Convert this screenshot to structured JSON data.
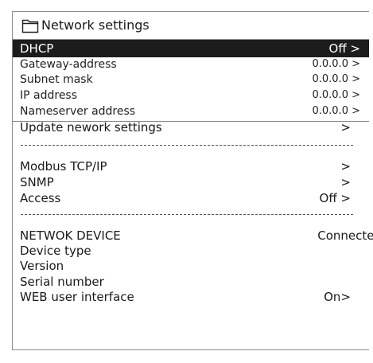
{
  "header": {
    "title": "Network settings",
    "icon": "folder-icon"
  },
  "network": [
    {
      "label": "DHCP",
      "value": "Off >"
    },
    {
      "label": "Gateway-address",
      "value": "0.0.0.0 >"
    },
    {
      "label": "Subnet mask",
      "value": "0.0.0.0 >"
    },
    {
      "label": "IP address",
      "value": "0.0.0.0 >"
    },
    {
      "label": "Nameserver address",
      "value": "0.0.0.0 >"
    }
  ],
  "update": {
    "label": "Update nework settings",
    "value": ">"
  },
  "protocols": [
    {
      "label": "Modbus TCP/IP",
      "value": ">"
    },
    {
      "label": "SNMP",
      "value": ">"
    },
    {
      "label": "Access",
      "value": "Off >"
    }
  ],
  "device": {
    "name_label": "NETWOK DEVICE",
    "name_value": "Connected",
    "type_label": "Device type",
    "version_label": "Version",
    "serial_label": "Serial number",
    "web_label": "WEB user interface",
    "web_value": "On>"
  },
  "colors": {
    "highlight": "#1c1c1c",
    "border": "#8a8a8a",
    "text": "#1a1a1a"
  }
}
